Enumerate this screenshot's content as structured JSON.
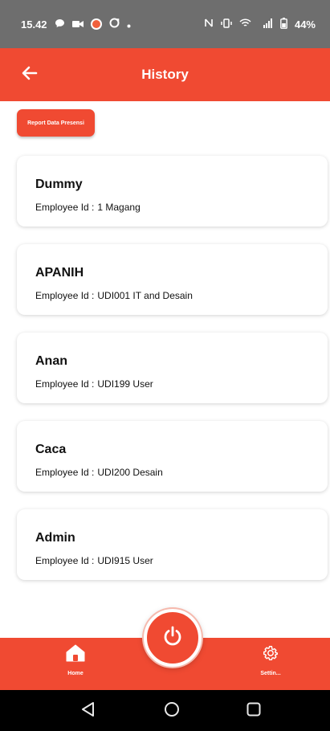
{
  "status_bar": {
    "time": "15.42",
    "battery": "44%"
  },
  "app_bar": {
    "title": "History"
  },
  "actions": {
    "report_button_label": "Report Data Presensi"
  },
  "employees": [
    {
      "name": "Dummy",
      "id_label": "Employee Id :",
      "id_value": "1 Magang"
    },
    {
      "name": "APANIH",
      "id_label": "Employee Id :",
      "id_value": "UDI001 IT and Desain"
    },
    {
      "name": "Anan",
      "id_label": "Employee Id :",
      "id_value": "UDI199 User"
    },
    {
      "name": "Caca",
      "id_label": "Employee Id :",
      "id_value": "UDI200 Desain"
    },
    {
      "name": "Admin",
      "id_label": "Employee Id :",
      "id_value": "UDI915 User"
    }
  ],
  "bottom_nav": {
    "home_label": "Home",
    "settings_label": "Settin..."
  },
  "colors": {
    "accent": "#f04a32",
    "status_bar": "#6e6e6e"
  },
  "icons": {
    "back": "arrow-left-icon",
    "power": "power-icon",
    "home": "home-icon",
    "settings": "gear-icon"
  }
}
